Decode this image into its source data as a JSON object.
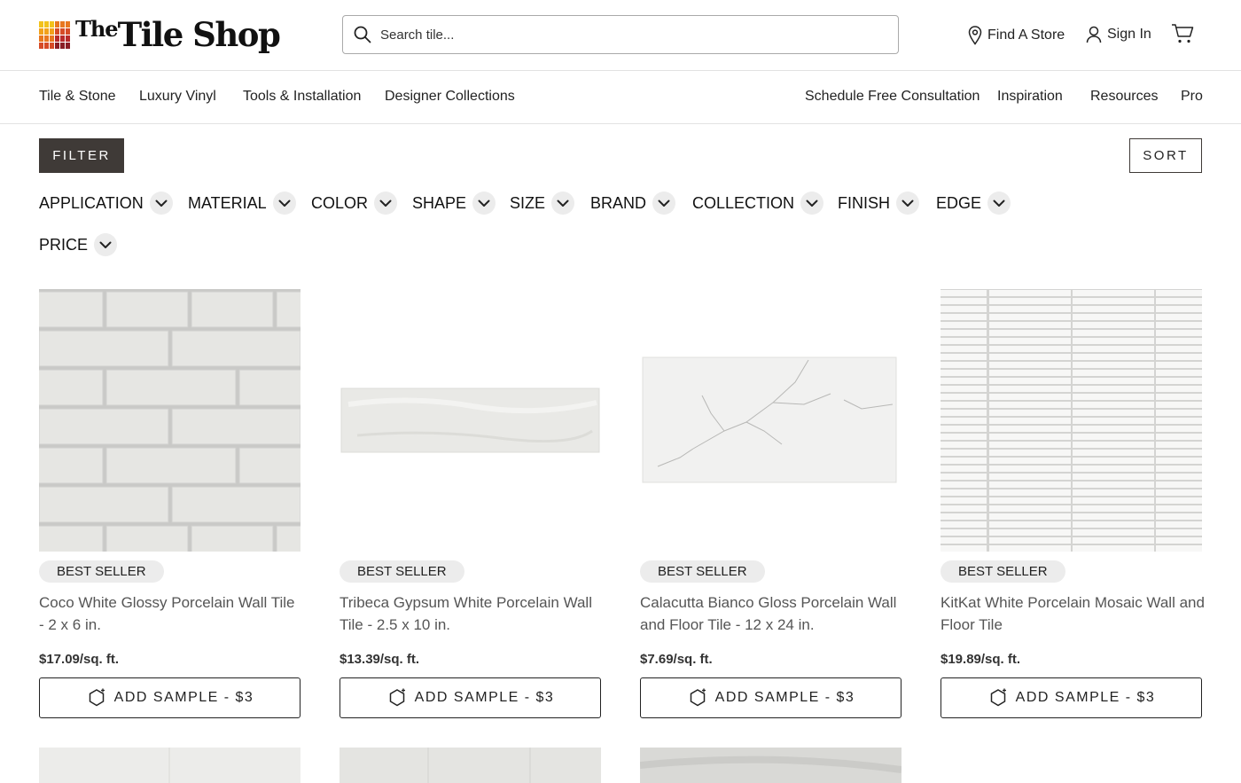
{
  "header": {
    "logo_text_the": "The",
    "logo_text_main": "Tile Shop",
    "search_placeholder": "Search tile...",
    "find_store": "Find A Store",
    "sign_in": "Sign In",
    "icons": {
      "search": "search-icon",
      "location": "map-pin-icon",
      "user": "user-icon",
      "cart": "cart-icon"
    },
    "logo_colors": [
      "#f2c21b",
      "#f2a11b",
      "#e8771f",
      "#d64b26",
      "#b82a2a",
      "#8a1e25"
    ]
  },
  "nav": {
    "left": [
      "Tile & Stone",
      "Luxury Vinyl",
      "Tools & Installation",
      "Designer Collections"
    ],
    "right": [
      "Schedule Free Consultation",
      "Inspiration",
      "Resources",
      "Pro"
    ]
  },
  "controls": {
    "filter": "FILTER",
    "sort": "SORT"
  },
  "facets": [
    "APPLICATION",
    "MATERIAL",
    "COLOR",
    "SHAPE",
    "SIZE",
    "BRAND",
    "COLLECTION",
    "FINISH",
    "EDGE",
    "PRICE"
  ],
  "products": [
    {
      "badge": "BEST SELLER",
      "name": "Coco White Glossy Porcelain Wall Tile - 2 x 6 in.",
      "price": "$17.09/sq. ft.",
      "button": "ADD SAMPLE - $3"
    },
    {
      "badge": "BEST SELLER",
      "name": "Tribeca Gypsum White Porcelain Wall Tile - 2.5 x 10 in.",
      "price": "$13.39/sq. ft.",
      "button": "ADD SAMPLE - $3"
    },
    {
      "badge": "BEST SELLER",
      "name": "Calacutta Bianco Gloss Porcelain Wall and Floor Tile - 12 x 24 in.",
      "price": "$7.69/sq. ft.",
      "button": "ADD SAMPLE - $3"
    },
    {
      "badge": "BEST SELLER",
      "name": "KitKat White Porcelain Mosaic Wall and Floor Tile",
      "price": "$19.89/sq. ft.",
      "button": "ADD SAMPLE - $3"
    }
  ]
}
